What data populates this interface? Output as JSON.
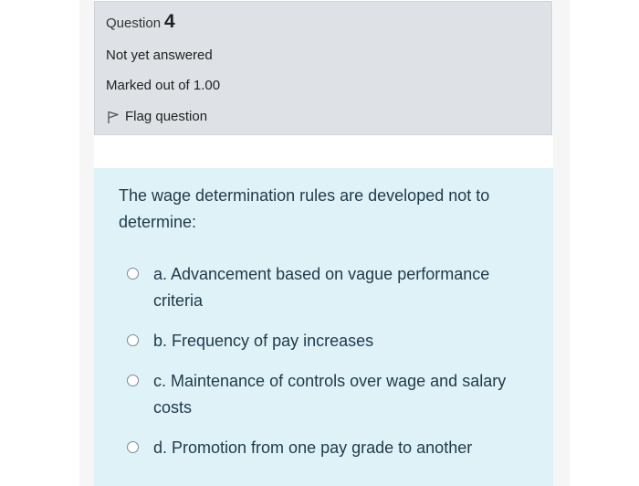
{
  "question": {
    "label": "Question",
    "number": "4",
    "status": "Not yet answered",
    "grade": "Marked out of 1.00",
    "flag_label": "Flag question",
    "flag_icon": "flag-icon",
    "prompt": "The wage determination rules are developed not to determine:"
  },
  "options": [
    {
      "text": "a. Advancement based on vague performance criteria",
      "selected": false
    },
    {
      "text": "b. Frequency of pay increases",
      "selected": false
    },
    {
      "text": "c. Maintenance of controls over wage and salary costs",
      "selected": false
    },
    {
      "text": "d. Promotion from one pay grade to another",
      "selected": false
    }
  ],
  "colors": {
    "info_panel_bg": "#dee2e6",
    "content_bg": "#def2f8",
    "text": "#1f3a4a"
  }
}
